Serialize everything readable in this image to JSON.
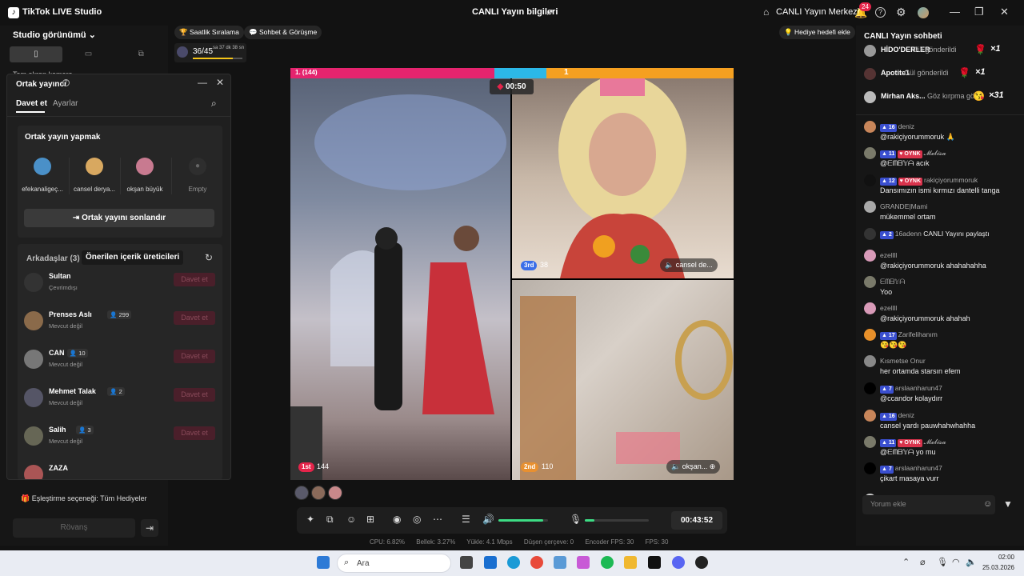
{
  "titlebar": {
    "app_name": "TikTok LIVE Studio",
    "center_title": "CANLI Yayın bilgileri",
    "live_center": "CANLI Yayın Merkezi",
    "notification_count": "24"
  },
  "left_panel": {
    "view_title": "Studio görünümü",
    "hidden_label": "Tam ekran kamera",
    "match_option": "Eşleştirme seçeneği: Tüm Hediyeler",
    "rematch_label": "Rövanş"
  },
  "cohost": {
    "title": "Ortak yayıncı",
    "tab_invite": "Davet et",
    "tab_settings": "Ayarlar",
    "section_title": "Ortak yayın yapmak",
    "slots": [
      {
        "name": "efekanaligeç...",
        "color": "#4a90c8"
      },
      {
        "name": "cansel derya...",
        "color": "#d8a860"
      },
      {
        "name": "okşan büyük",
        "color": "#c87a90"
      },
      {
        "name": "Empty",
        "color": "#2e2e2e"
      }
    ],
    "end_button": "Ortak yayını sonlandır",
    "friends_tab": "Arkadaşlar (3)",
    "suggested_tab": "Önerilen içerik üreticileri",
    "invite_label": "Davet et",
    "friends": [
      {
        "name": "Sultan",
        "status": "Çevrimdışı",
        "badge": "",
        "color": "#333"
      },
      {
        "name": "Prenses Aslı",
        "status": "Mevcut değil",
        "badge": "299",
        "color": "#8a6a4a"
      },
      {
        "name": "CAN",
        "status": "Mevcut değil",
        "badge": "10",
        "color": "#777"
      },
      {
        "name": "Mehmet Talak",
        "status": "Mevcut değil",
        "badge": "2",
        "color": "#556"
      },
      {
        "name": "Salih",
        "status": "Mevcut değil",
        "badge": "3",
        "color": "#665"
      },
      {
        "name": "ZAZA",
        "status": "",
        "badge": "",
        "color": "#a55"
      }
    ]
  },
  "top_chips": {
    "hourly_ranking": "Saatlik Sıralama",
    "chat_meet": "Sohbet & Görüşme",
    "gift_goal": "Hediye hedefi ekle"
  },
  "level": {
    "value": "36/45",
    "remaining": "sa 37 dk 38 sn",
    "progress": 0.8
  },
  "stage": {
    "pk_left_label": "1. (144)",
    "pk_right_label": "1",
    "timer": "00:50",
    "videos": [
      {
        "rank": "1st",
        "score": "144",
        "rank_color": "#e5244a",
        "name": ""
      },
      {
        "rank": "3rd",
        "score": "38",
        "rank_color": "#3a6ee8",
        "name": "cansel de..."
      },
      {
        "rank": "2nd",
        "score": "110",
        "rank_color": "#e89030",
        "name": "okşan..."
      }
    ]
  },
  "controls": {
    "elapsed": "00:43:52",
    "volume": 0.9,
    "mic_level": 0.15
  },
  "stats": {
    "cpu": "CPU: 6.82%",
    "memory": "Bellek: 3.27%",
    "upload": "Yükle: 4.1 Mbps",
    "dropped": "Düşen çerçeve: 0",
    "encoder_fps": "Encoder FPS: 30",
    "fps": "FPS: 30"
  },
  "chat": {
    "title": "CANLI Yayın sohbeti",
    "gifts": [
      {
        "user": "HİDO'DERLER",
        "text": "Gül gönderildi",
        "count": "×1",
        "icon": "🌹",
        "color": "#999"
      },
      {
        "user": "Apotite1",
        "text": "Gül gönderildi",
        "count": "×1",
        "icon": "🌹",
        "color": "#533"
      },
      {
        "user": "Mirhan Aks...",
        "text": "Göz kırpma gö",
        "count": "×31",
        "icon": "😘",
        "color": "#bbb"
      }
    ],
    "messages": [
      {
        "level": "16",
        "fan": "",
        "user": "deniz",
        "text": "@rakiçiyorummoruk 🙏",
        "color": "#c8865a"
      },
      {
        "level": "11",
        "fan": "OYNK",
        "user": "𝓜𝓮𝓵𝓲𝓼𝓪",
        "text": "@ᗴᗰᗷ𝕐ᗩ acık",
        "color": "#7a7a6a"
      },
      {
        "level": "12",
        "fan": "OYNK",
        "user": "rakiçiyorummoruk",
        "text": "Dansımızın ismi kırmızı dantelli tanga",
        "color": "#111"
      },
      {
        "level": "",
        "fan": "",
        "user": "GRANDE|Mami",
        "text": "mükemmel ortam",
        "color": "#aaa"
      },
      {
        "level": "2",
        "fan": "",
        "user": "16adenn",
        "text": "CANLI Yayını paylaştı",
        "color": "#333"
      },
      {
        "level": "",
        "fan": "",
        "user": "ezellll",
        "text": "@rakiçiyorummoruk ahahahahha",
        "color": "#d89ab8"
      },
      {
        "level": "",
        "fan": "",
        "user": "ᗴᗰᗷ𝕐ᗩ",
        "text": "Yoo",
        "color": "#7a7a6a"
      },
      {
        "level": "",
        "fan": "",
        "user": "ezellll",
        "text": "@rakiçiyorummoruk ahahah",
        "color": "#d89ab8"
      },
      {
        "level": "17",
        "fan": "",
        "user": "Zarifelihanım",
        "text": "😘😘😘",
        "color": "#e8902a"
      },
      {
        "level": "",
        "fan": "",
        "user": "Kısmetse Onur",
        "text": "her ortamda starsın efem",
        "color": "#888"
      },
      {
        "level": "7",
        "fan": "",
        "user": "arslaanharun47",
        "text": "@ccandor kolaydırr",
        "color": "#000"
      },
      {
        "level": "16",
        "fan": "",
        "user": "deniz",
        "text": "cansel yardı pauwhahwhahha",
        "color": "#c8865a"
      },
      {
        "level": "11",
        "fan": "OYNK",
        "user": "𝓜𝓮𝓵𝓲𝓼𝓪",
        "text": "@ᗴᗰᗷ𝕐ᗩ yo mu",
        "color": "#7a7a6a"
      },
      {
        "level": "7",
        "fan": "",
        "user": "arslaanharun47",
        "text": "çikart masaya vurr",
        "color": "#000"
      },
      {
        "level": "",
        "fan": "",
        "user": "firuz",
        "text": "katıldı",
        "color": "#ccc"
      }
    ],
    "comment_placeholder": "Yorum ekle"
  },
  "taskbar": {
    "search_label": "Ara",
    "time": "02:00",
    "date": "25.03.2026"
  }
}
